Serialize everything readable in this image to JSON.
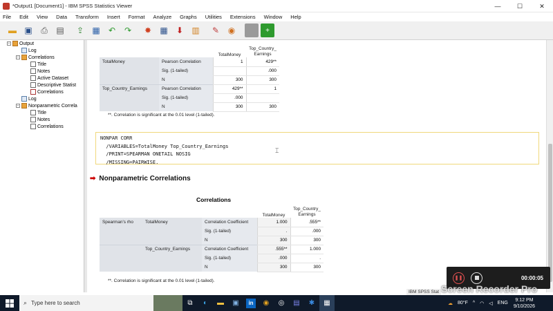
{
  "window": {
    "title": "*Output1 [Document1] - IBM SPSS Statistics Viewer",
    "minimize": "—",
    "maximize": "☐",
    "close": "✕"
  },
  "menu": [
    "File",
    "Edit",
    "View",
    "Data",
    "Transform",
    "Insert",
    "Format",
    "Analyze",
    "Graphs",
    "Utilities",
    "Extensions",
    "Window",
    "Help"
  ],
  "toolbar_icons": [
    "open-folder-icon",
    "save-icon",
    "print-icon",
    "print-preview-icon",
    "export-icon",
    "recall-dialog-icon",
    "undo-icon",
    "redo-icon",
    "goto-data-icon",
    "goto-case-icon",
    "goto-variable-icon",
    "variables-icon",
    "spell-icon",
    "designate-window-icon",
    "show-all-icon",
    "insert-icon"
  ],
  "nav_tree": [
    {
      "label": "Output",
      "icon": "book",
      "level": 0,
      "expander": "−"
    },
    {
      "label": "Log",
      "icon": "log",
      "level": 1,
      "expander": ""
    },
    {
      "label": "Correlations",
      "icon": "book",
      "level": 1,
      "expander": "−"
    },
    {
      "label": "Title",
      "icon": "tbl",
      "level": 2,
      "expander": ""
    },
    {
      "label": "Notes",
      "icon": "tbl",
      "level": 2,
      "expander": ""
    },
    {
      "label": "Active Dataset",
      "icon": "tbl",
      "level": 2,
      "expander": ""
    },
    {
      "label": "Descriptive Statist",
      "icon": "tbl",
      "level": 2,
      "expander": ""
    },
    {
      "label": "Correlations",
      "icon": "tbl-red",
      "level": 2,
      "expander": ""
    },
    {
      "label": "Log",
      "icon": "log",
      "level": 1,
      "expander": ""
    },
    {
      "label": "Nonparametric Correla",
      "icon": "book",
      "level": 1,
      "expander": "−"
    },
    {
      "label": "Title",
      "icon": "tbl",
      "level": 2,
      "expander": ""
    },
    {
      "label": "Notes",
      "icon": "tbl",
      "level": 2,
      "expander": ""
    },
    {
      "label": "Correlations",
      "icon": "tbl",
      "level": 2,
      "expander": ""
    }
  ],
  "pearson_table": {
    "col_headers": [
      "TotalMoney",
      "Top_Country_\nEarnings"
    ],
    "rows": [
      {
        "var": "TotalMoney",
        "stat": "Pearson Correlation",
        "v1": "1",
        "v2": "429**"
      },
      {
        "var": "",
        "stat": "Sig. (1-tailed)",
        "v1": "",
        "v2": ".000"
      },
      {
        "var": "",
        "stat": "N",
        "v1": "300",
        "v2": "300"
      },
      {
        "var": "Top_Country_Earnings",
        "stat": "Pearson Correlation",
        "v1": "429**",
        "v2": "1"
      },
      {
        "var": "",
        "stat": "Sig. (1-tailed)",
        "v1": ".000",
        "v2": ""
      },
      {
        "var": "",
        "stat": "N",
        "v1": "300",
        "v2": "300"
      }
    ],
    "footnote": "**. Correlation is significant at the 0.01 level (1-tailed)."
  },
  "syntax_lines": [
    "NONPAR CORR",
    "  /VARIABLES=TotalMoney Top_Country_Earnings",
    "  /PRINT=SPEARMAN ONETAIL NOSIG",
    "  /MISSING=PAIRWISE."
  ],
  "section_heading": "Nonparametric Correlations",
  "spearman_table": {
    "title": "Correlations",
    "col_headers": [
      "TotalMoney",
      "Top_Country_\nEarnings"
    ],
    "rows": [
      {
        "g": "Spearman's rho",
        "var": "TotalMoney",
        "stat": "Correlation Coefficient",
        "v1": "1.000",
        "v2": ".555**"
      },
      {
        "g": "",
        "var": "",
        "stat": "Sig. (1-tailed)",
        "v1": ".",
        "v2": ".000"
      },
      {
        "g": "",
        "var": "",
        "stat": "N",
        "v1": "300",
        "v2": "300"
      },
      {
        "g": "",
        "var": "Top_Country_Earnings",
        "stat": "Correlation Coefficient",
        "v1": ".555**",
        "v2": "1.000"
      },
      {
        "g": "",
        "var": "",
        "stat": "Sig. (1-tailed)",
        "v1": ".000",
        "v2": "."
      },
      {
        "g": "",
        "var": "",
        "stat": "N",
        "v1": "300",
        "v2": "300"
      }
    ],
    "footnote": "**. Correlation is significant at the 0.01 level (1-tailed)."
  },
  "status_bar": "IBM SPSS Stat",
  "recorder": {
    "time": "00:00:05",
    "watermark": "Screen Recorder Pro"
  },
  "taskbar": {
    "search_placeholder": "Type here to search",
    "weather": "80°F",
    "language": "ENG",
    "time": "9:12 PM",
    "date": "9/10/2026",
    "apps": [
      "task-view-icon",
      "edge-icon",
      "file-explorer-icon",
      "store-icon",
      "linkedin-icon",
      "chrome-icon",
      "circle-app-icon",
      "teams-icon",
      "bluetooth-icon",
      "spss-icon"
    ]
  }
}
